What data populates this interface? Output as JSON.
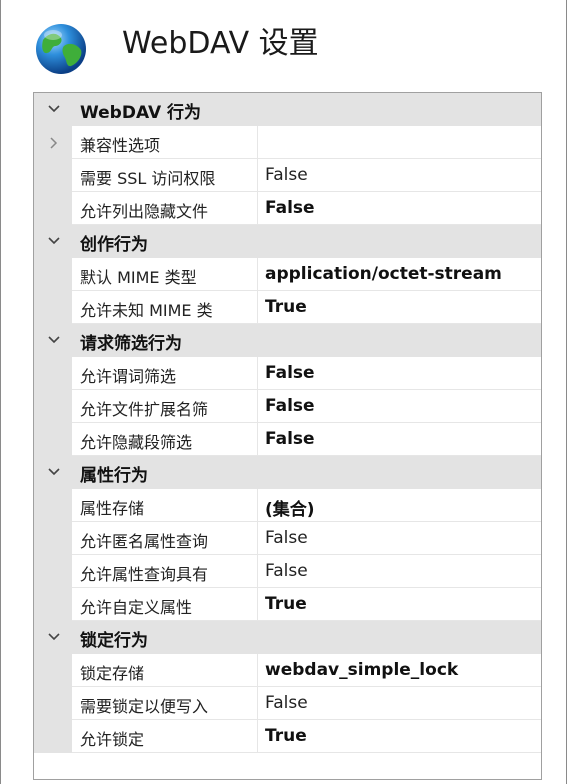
{
  "header": {
    "title": "WebDAV 设置"
  },
  "grid": {
    "sections": [
      {
        "label": "WebDAV 行为",
        "items": [
          {
            "name": "兼容性选项",
            "value": "",
            "bold": false,
            "expandable": true
          },
          {
            "name": "需要 SSL 访问权限",
            "value": "False",
            "bold": false
          },
          {
            "name": "允许列出隐藏文件",
            "value": "False",
            "bold": true
          }
        ]
      },
      {
        "label": "创作行为",
        "items": [
          {
            "name": "默认 MIME 类型",
            "value": "application/octet-stream",
            "bold": true
          },
          {
            "name": "允许未知 MIME 类",
            "value": "True",
            "bold": true
          }
        ]
      },
      {
        "label": "请求筛选行为",
        "items": [
          {
            "name": "允许谓词筛选",
            "value": "False",
            "bold": true
          },
          {
            "name": "允许文件扩展名筛",
            "value": "False",
            "bold": true
          },
          {
            "name": "允许隐藏段筛选",
            "value": "False",
            "bold": true
          }
        ]
      },
      {
        "label": "属性行为",
        "items": [
          {
            "name": "属性存储",
            "value": "(集合)",
            "bold": true
          },
          {
            "name": "允许匿名属性查询",
            "value": "False",
            "bold": false
          },
          {
            "name": "允许属性查询具有",
            "value": "False",
            "bold": false
          },
          {
            "name": "允许自定义属性",
            "value": "True",
            "bold": true
          }
        ]
      },
      {
        "label": "锁定行为",
        "items": [
          {
            "name": "锁定存储",
            "value": "webdav_simple_lock",
            "bold": true
          },
          {
            "name": "需要锁定以便写入",
            "value": "False",
            "bold": false
          },
          {
            "name": "允许锁定",
            "value": "True",
            "bold": true
          }
        ]
      }
    ]
  },
  "icons": {
    "header": "globe-icon",
    "section_toggle": "chevron-down-icon",
    "item_expander": "chevron-right-icon"
  },
  "colors": {
    "category_background": "#e3e3e3",
    "grid_border": "#a0a0a0"
  }
}
